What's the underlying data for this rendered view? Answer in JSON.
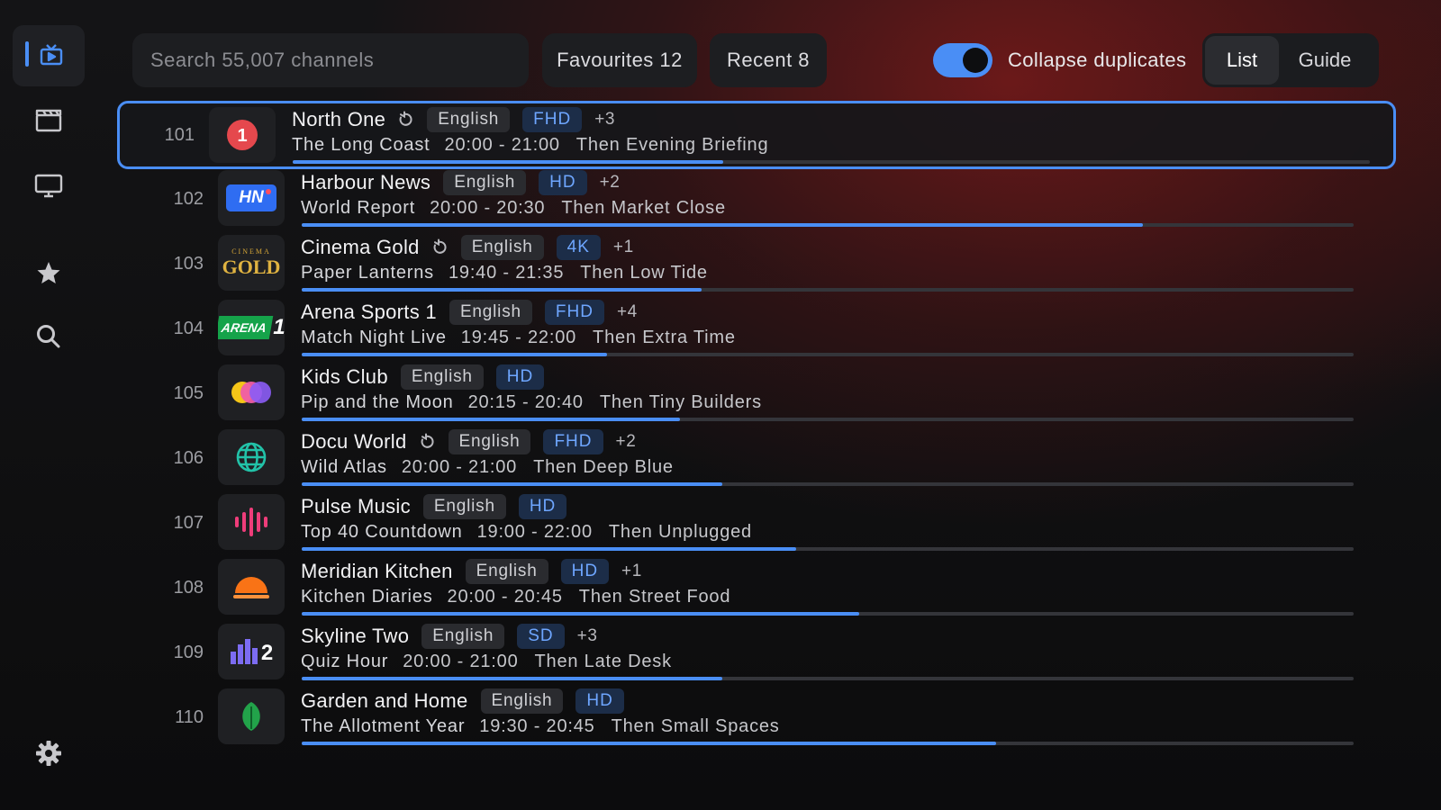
{
  "colors": {
    "accent": "#4a8ef5",
    "quality_text": "#6ea6ff",
    "background": "#0f0f11"
  },
  "sidebar": {
    "items": [
      {
        "icon": "live-tv-icon",
        "active": true
      },
      {
        "icon": "clapperboard-icon",
        "active": false
      },
      {
        "icon": "monitor-icon",
        "active": false
      },
      {
        "icon": "star-icon",
        "active": false
      },
      {
        "icon": "search-icon",
        "active": false
      },
      {
        "icon": "gear-icon",
        "active": false
      }
    ]
  },
  "topbar": {
    "search_placeholder": "Search 55,007 channels",
    "favourites_label": "Favourites 12",
    "recent_label": "Recent 8",
    "collapse_label": "Collapse duplicates",
    "collapse_on": true,
    "view_list": "List",
    "view_guide": "Guide",
    "selected_view": "List"
  },
  "channels": [
    {
      "number": "101",
      "name": "North One",
      "restart": true,
      "language": "English",
      "quality": "FHD",
      "extra": "+3",
      "program": "The Long Coast",
      "time": "20:00 - 21:00",
      "next": "Then Evening Briefing",
      "progress": 0.4,
      "logo": "north-one-logo",
      "selected": true
    },
    {
      "number": "102",
      "name": "Harbour News",
      "restart": false,
      "language": "English",
      "quality": "HD",
      "extra": "+2",
      "program": "World Report",
      "time": "20:00 - 20:30",
      "next": "Then Market Close",
      "progress": 0.8,
      "logo": "harbour-news-logo",
      "logo_text": "HN",
      "selected": false
    },
    {
      "number": "103",
      "name": "Cinema Gold",
      "restart": true,
      "language": "English",
      "quality": "4K",
      "extra": "+1",
      "program": "Paper Lanterns",
      "time": "19:40 - 21:35",
      "next": "Then Low Tide",
      "progress": 0.38,
      "logo": "cinema-gold-logo",
      "logo_small": "CINEMA",
      "logo_text": "GOLD",
      "selected": false
    },
    {
      "number": "104",
      "name": "Arena Sports 1",
      "restart": false,
      "language": "English",
      "quality": "FHD",
      "extra": "+4",
      "program": "Match Night Live",
      "time": "19:45 - 22:00",
      "next": "Then Extra Time",
      "progress": 0.29,
      "logo": "arena-sports-logo",
      "logo_text": "ARENA",
      "logo_digit": "1",
      "selected": false
    },
    {
      "number": "105",
      "name": "Kids Club",
      "restart": false,
      "language": "English",
      "quality": "HD",
      "extra": "",
      "program": "Pip and the Moon",
      "time": "20:15 - 20:40",
      "next": "Then Tiny Builders",
      "progress": 0.36,
      "logo": "kids-club-logo",
      "selected": false
    },
    {
      "number": "106",
      "name": "Docu World",
      "restart": true,
      "language": "English",
      "quality": "FHD",
      "extra": "+2",
      "program": "Wild Atlas",
      "time": "20:00 - 21:00",
      "next": "Then Deep Blue",
      "progress": 0.4,
      "logo": "docu-world-logo",
      "selected": false
    },
    {
      "number": "107",
      "name": "Pulse Music",
      "restart": false,
      "language": "English",
      "quality": "HD",
      "extra": "",
      "program": "Top 40 Countdown",
      "time": "19:00 - 22:00",
      "next": "Then Unplugged",
      "progress": 0.47,
      "logo": "pulse-music-logo",
      "selected": false
    },
    {
      "number": "108",
      "name": "Meridian Kitchen",
      "restart": false,
      "language": "English",
      "quality": "HD",
      "extra": "+1",
      "program": "Kitchen Diaries",
      "time": "20:00 - 20:45",
      "next": "Then Street Food",
      "progress": 0.53,
      "logo": "meridian-kitchen-logo",
      "selected": false
    },
    {
      "number": "109",
      "name": "Skyline Two",
      "restart": false,
      "language": "English",
      "quality": "SD",
      "extra": "+3",
      "program": "Quiz Hour",
      "time": "20:00 - 21:00",
      "next": "Then Late Desk",
      "progress": 0.4,
      "logo": "skyline-two-logo",
      "logo_digit": "2",
      "selected": false
    },
    {
      "number": "110",
      "name": "Garden and Home",
      "restart": false,
      "language": "English",
      "quality": "HD",
      "extra": "",
      "program": "The Allotment Year",
      "time": "19:30 - 20:45",
      "next": "Then Small Spaces",
      "progress": 0.66,
      "logo": "garden-home-logo",
      "selected": false
    }
  ]
}
